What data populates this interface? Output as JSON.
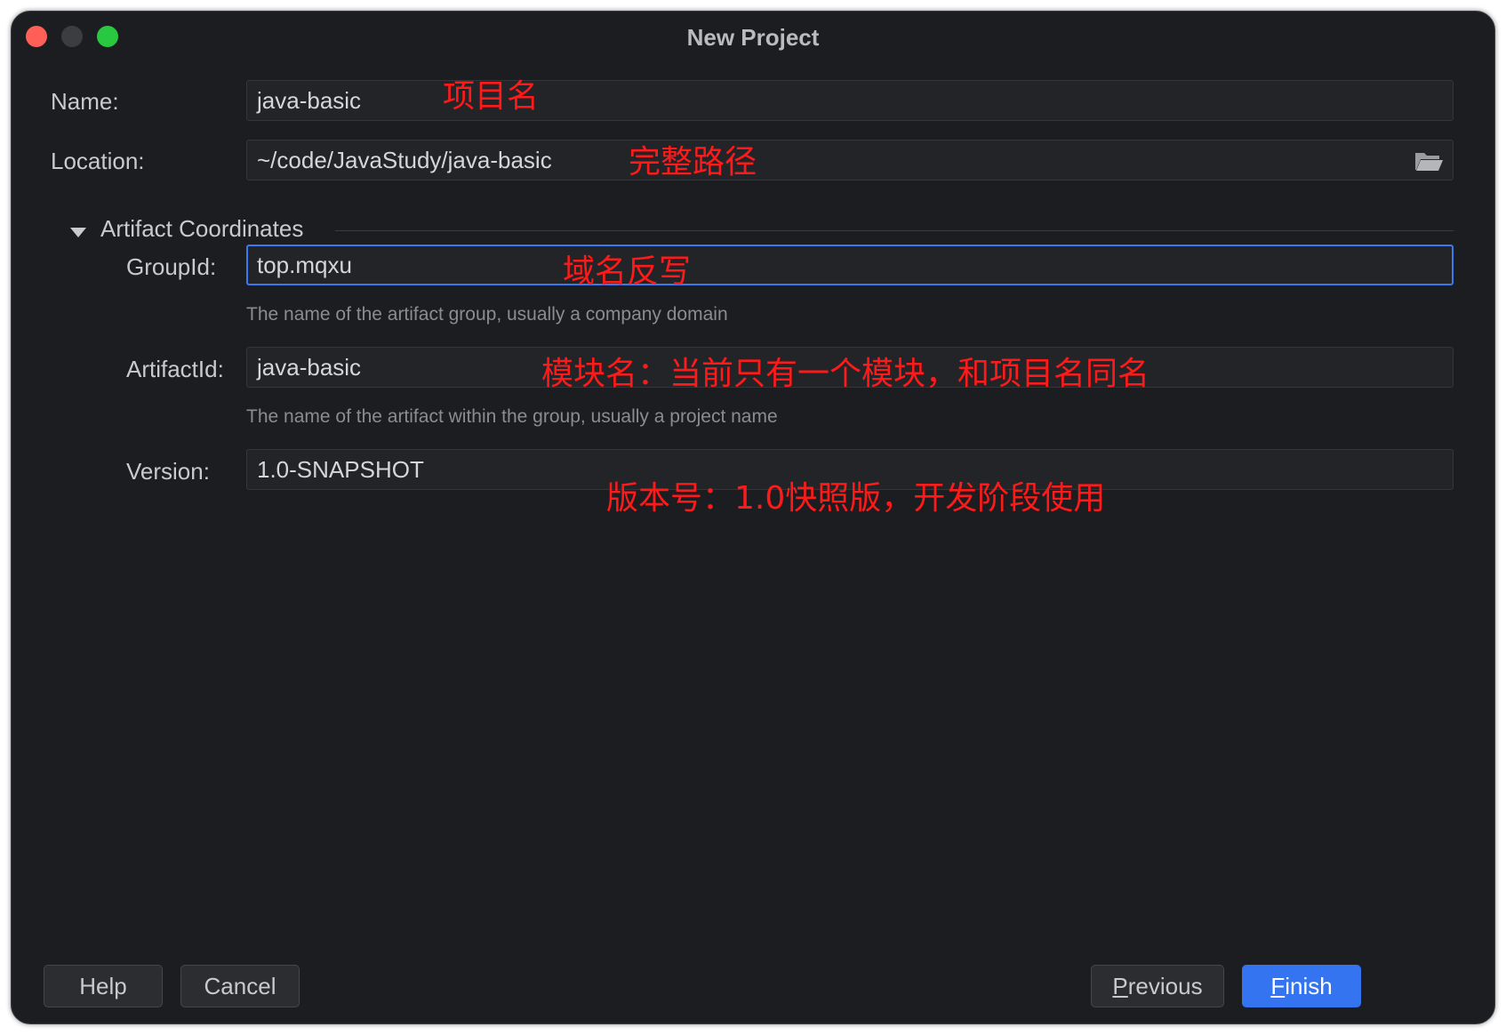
{
  "window": {
    "title": "New Project"
  },
  "form": {
    "name": {
      "label": "Name:",
      "value": "java-basic"
    },
    "location": {
      "label": "Location:",
      "value": "~/code/JavaStudy/java-basic",
      "icon": "folder-icon"
    },
    "section": {
      "label": "Artifact Coordinates",
      "icon": "triangle-down-icon"
    },
    "group_id": {
      "label": "GroupId:",
      "value": "top.mqxu",
      "hint": "The name of the artifact group, usually a company domain"
    },
    "artifact_id": {
      "label": "ArtifactId:",
      "value": "java-basic",
      "hint": "The name of the artifact within the group, usually a project name"
    },
    "version": {
      "label": "Version:",
      "value": "1.0-SNAPSHOT"
    }
  },
  "annotations": {
    "name": "项目名",
    "location": "完整路径",
    "group_id": "域名反写",
    "artifact_id": "模块名：当前只有一个模块，和项目名同名",
    "version": "版本号：1.0快照版，开发阶段使用"
  },
  "buttons": {
    "help": "Help",
    "cancel": "Cancel",
    "previous_mnemonic": "P",
    "previous_rest": "revious",
    "finish_mnemonic": "F",
    "finish_rest": "inish"
  },
  "colors": {
    "background": "#1c1d20",
    "field": "#232428",
    "focus_border": "#3a79ee",
    "primary": "#3574f0",
    "annotation": "#ff1a1a",
    "close": "#fe5f57",
    "maximize": "#28c840"
  }
}
